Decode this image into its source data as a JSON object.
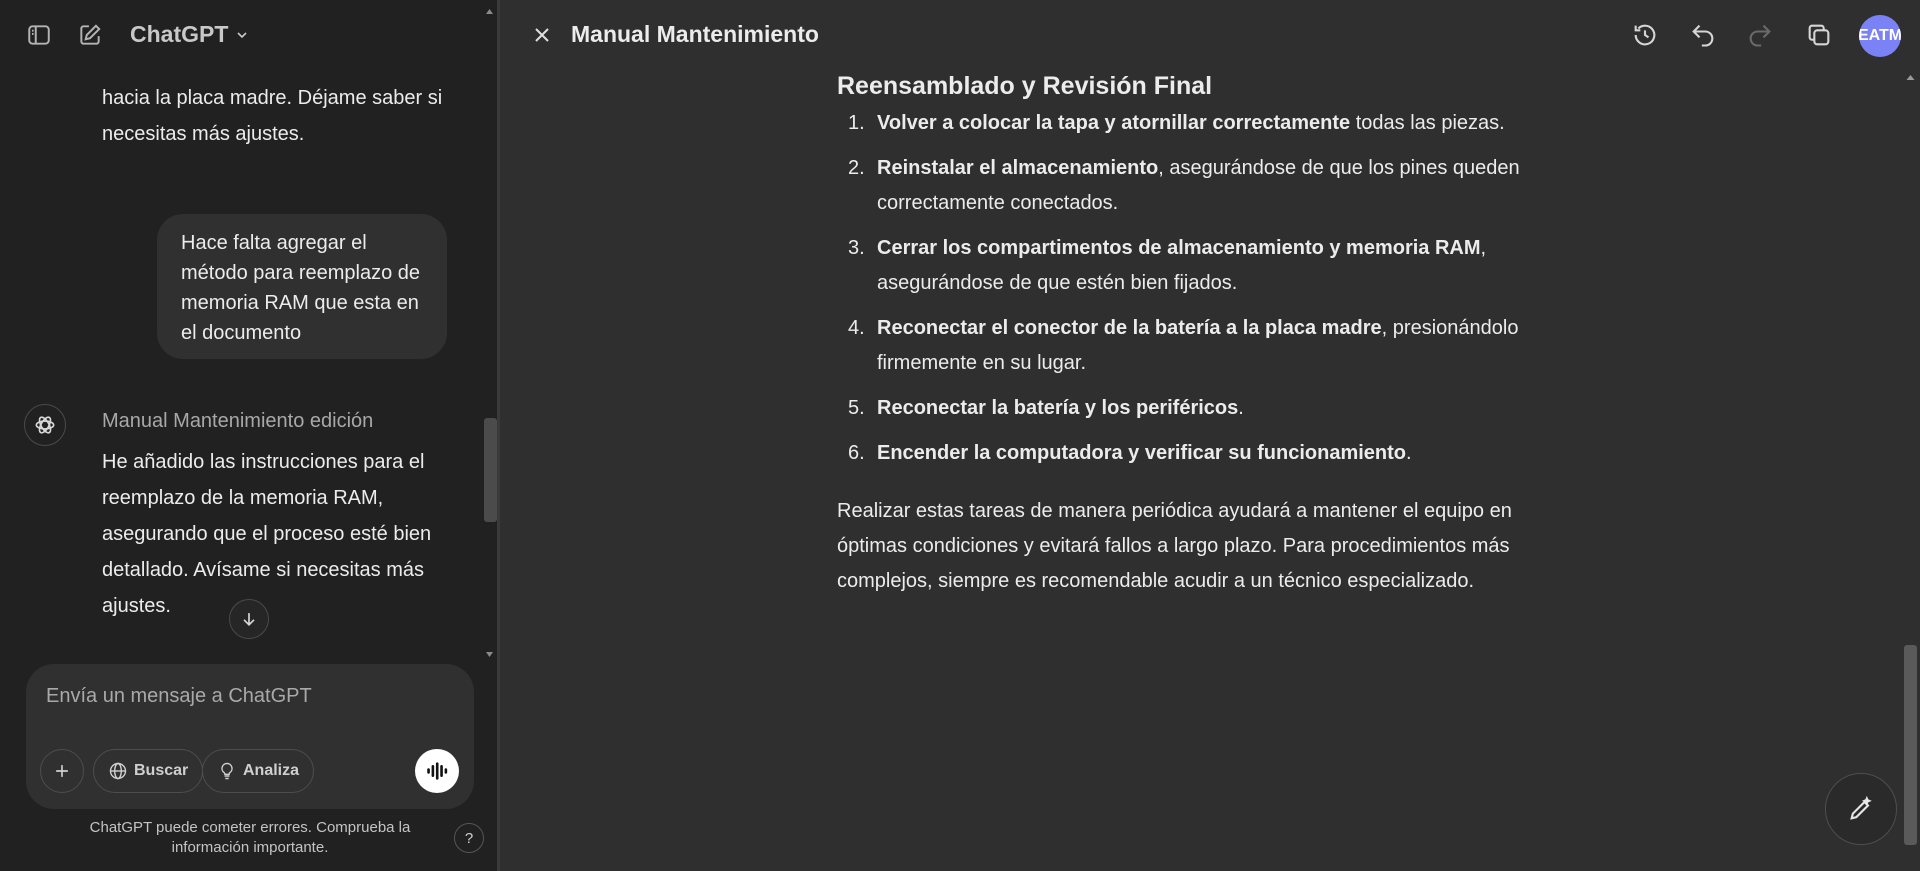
{
  "header_left": {
    "model_name": "ChatGPT"
  },
  "chat": {
    "assistant_prev_text": "hacia la placa madre. Déjame saber si necesitas más ajustes.",
    "user_message": "Hace falta agregar el método para reemplazo de memoria RAM que esta en el documento",
    "canvas_reference": "Manual Mantenimiento edición",
    "assistant_reply": "He añadido las instrucciones para el reemplazo de la memoria RAM, asegurando que el proceso esté bien detallado. Avísame si necesitas más ajustes."
  },
  "composer": {
    "placeholder": "Envía un mensaje a ChatGPT",
    "search_label": "Buscar",
    "reason_label": "Analiza"
  },
  "footer": {
    "disclaimer": "ChatGPT puede cometer errores. Comprueba la información importante.",
    "help": "?"
  },
  "canvas": {
    "title": "Manual Mantenimiento",
    "avatar_initials": "EATM",
    "section_heading": "Reensamblado y Revisión Final",
    "steps": [
      {
        "num": "1.",
        "bold": "Volver a colocar la tapa y atornillar correctamente",
        "rest": " todas las piezas."
      },
      {
        "num": "2.",
        "bold": "Reinstalar el almacenamiento",
        "rest": ", asegurándose de que los pines queden correctamente conectados."
      },
      {
        "num": "3.",
        "bold": "Cerrar los compartimentos de almacenamiento y memoria RAM",
        "rest": ", asegurándose de que estén bien fijados."
      },
      {
        "num": "4.",
        "bold": "Reconectar el conector de la batería a la placa madre",
        "rest": ", presionándolo firmemente en su lugar."
      },
      {
        "num": "5.",
        "bold": "Reconectar la batería y los periféricos",
        "rest": "."
      },
      {
        "num": "6.",
        "bold": "Encender la computadora y verificar su funcionamiento",
        "rest": "."
      }
    ],
    "closing_paragraph": "Realizar estas tareas de manera periódica ayudará a mantener el equipo en óptimas condiciones y evitará fallos a largo plazo. Para procedimientos más complejos, siempre es recomendable acudir a un técnico especializado."
  },
  "icons": {
    "sidebar_toggle": "sidebar-icon",
    "new_chat": "compose-icon",
    "close": "close-icon",
    "history": "history-icon",
    "undo": "undo-icon",
    "redo": "redo-icon",
    "copy": "copy-icon",
    "edit": "edit-pen-icon"
  },
  "colors": {
    "sidebar_bg": "#212121",
    "canvas_bg": "#2f2f2f",
    "bubble_bg": "#303030",
    "avatar_bg": "#7b82f5"
  }
}
